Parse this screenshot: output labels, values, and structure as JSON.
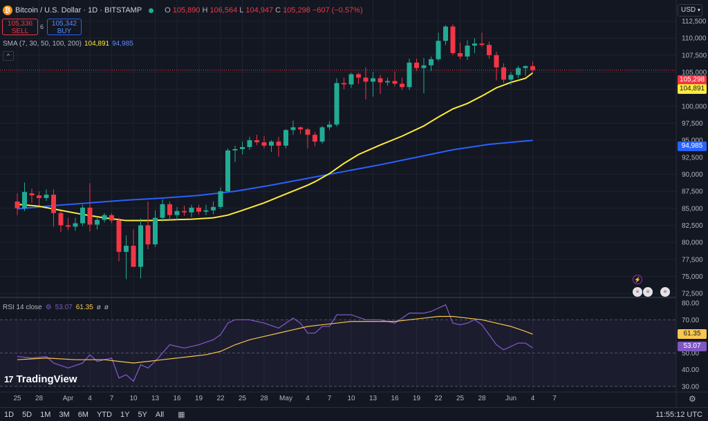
{
  "header": {
    "symbol": "Bitcoin / U.S. Dollar · 1D · BITSTAMP",
    "o_label": "O",
    "o_value": "105,890",
    "h_label": "H",
    "h_value": "106,564",
    "l_label": "L",
    "l_value": "104,947",
    "c_label": "C",
    "c_value": "105,298",
    "change": "−607 (−0.57%)"
  },
  "trade": {
    "sell_price": "105,336",
    "sell_label": "SELL",
    "spread": "6",
    "buy_price": "105,342",
    "buy_label": "BUY"
  },
  "indicators": {
    "sma_label": "SMA (7, 30, 50, 100, 200)",
    "sma_value_1": "104,891",
    "sma_value_2": "94,985",
    "rsi_label": "RSI 14 close",
    "rsi_value": "53.07",
    "rsi_ma_value": "61.35",
    "rsi_extra_1": "ø",
    "rsi_extra_2": "ø"
  },
  "currency_button": "USD",
  "price_tags": {
    "last": "105,298",
    "sma_fast": "104,891",
    "sma_slow": "94,985",
    "rsi_ma": "61.35",
    "rsi": "53.07"
  },
  "colors": {
    "up": "#22ab94",
    "down": "#f23645",
    "sma_fast": "#ffeb3b",
    "sma_slow": "#2962ff",
    "rsi": "#7e57c2",
    "rsi_ma": "#f9c74f"
  },
  "branding": "TradingView",
  "timeframes": [
    "1D",
    "5D",
    "1M",
    "3M",
    "6M",
    "YTD",
    "1Y",
    "5Y",
    "All"
  ],
  "clock": "11:55:12 UTC",
  "chart_data": {
    "type": "candlestick",
    "price_axis_labels": [
      "112,500",
      "110,000",
      "107,500",
      "105,000",
      "102,500",
      "100,000",
      "97,500",
      "95,000",
      "92,500",
      "90,000",
      "87,500",
      "85,000",
      "82,500",
      "80,000",
      "77,500",
      "75,000",
      "72,500"
    ],
    "price_ticks": [
      112500,
      110000,
      107500,
      105000,
      102500,
      100000,
      97500,
      95000,
      92500,
      90000,
      87500,
      85000,
      82500,
      80000,
      77500,
      75000,
      72500
    ],
    "ylim": [
      71800,
      115600
    ],
    "x_labels": [
      "25",
      "28",
      "Apr",
      "4",
      "7",
      "10",
      "13",
      "16",
      "19",
      "22",
      "25",
      "28",
      "May",
      "4",
      "7",
      "10",
      "13",
      "16",
      "19",
      "22",
      "25",
      "28",
      "Jun",
      "4",
      "7"
    ],
    "x_label_days": [
      0,
      3,
      7,
      10,
      13,
      16,
      19,
      22,
      25,
      28,
      31,
      34,
      37,
      40,
      43,
      46,
      49,
      52,
      55,
      58,
      61,
      64,
      68,
      71,
      74
    ],
    "candles": [
      [
        0,
        86000,
        87200,
        84000,
        85000
      ],
      [
        1,
        85000,
        88800,
        84600,
        87400
      ],
      [
        2,
        87200,
        87900,
        85800,
        86900
      ],
      [
        3,
        86900,
        87500,
        85400,
        86500
      ],
      [
        4,
        86500,
        87800,
        86100,
        87000
      ],
      [
        5,
        87000,
        87800,
        82300,
        84300
      ],
      [
        6,
        84300,
        84600,
        81500,
        82500
      ],
      [
        7,
        82500,
        83600,
        81800,
        82300
      ],
      [
        8,
        82300,
        83600,
        81700,
        82800
      ],
      [
        9,
        82800,
        85500,
        82400,
        85100
      ],
      [
        10,
        85100,
        88700,
        81600,
        82600
      ],
      [
        11,
        82600,
        83800,
        81900,
        83300
      ],
      [
        12,
        83300,
        84300,
        82900,
        84000
      ],
      [
        13,
        84000,
        84300,
        82800,
        83200
      ],
      [
        14,
        83200,
        83600,
        77200,
        78600
      ],
      [
        15,
        78600,
        81000,
        74600,
        79500
      ],
      [
        16,
        79500,
        81900,
        76600,
        76400
      ],
      [
        17,
        76400,
        83500,
        74700,
        82500
      ],
      [
        18,
        82500,
        86000,
        79000,
        79700
      ],
      [
        19,
        79700,
        84700,
        79300,
        83600
      ],
      [
        20,
        83600,
        86300,
        83000,
        85600
      ],
      [
        21,
        85600,
        86000,
        83300,
        84000
      ],
      [
        22,
        84000,
        85200,
        83300,
        84600
      ],
      [
        23,
        84600,
        85400,
        83900,
        84400
      ],
      [
        24,
        84400,
        85500,
        83700,
        85100
      ],
      [
        25,
        85100,
        85500,
        84100,
        84500
      ],
      [
        26,
        84500,
        85500,
        84000,
        84700
      ],
      [
        27,
        84700,
        86000,
        84100,
        85200
      ],
      [
        28,
        85200,
        88100,
        84900,
        87500
      ],
      [
        29,
        87500,
        93800,
        87400,
        93500
      ],
      [
        30,
        93500,
        94200,
        91800,
        93700
      ],
      [
        31,
        93700,
        94800,
        92900,
        94000
      ],
      [
        32,
        94000,
        95500,
        93600,
        95000
      ],
      [
        33,
        95000,
        95800,
        94300,
        94700
      ],
      [
        34,
        94700,
        95600,
        93800,
        94200
      ],
      [
        35,
        94200,
        95000,
        93300,
        94800
      ],
      [
        36,
        94800,
        95500,
        92600,
        94200
      ],
      [
        37,
        94200,
        96600,
        93800,
        96500
      ],
      [
        38,
        96500,
        97900,
        95800,
        96900
      ],
      [
        39,
        96900,
        97000,
        95900,
        96600
      ],
      [
        40,
        96600,
        96800,
        93800,
        95800
      ],
      [
        41,
        95800,
        96200,
        94100,
        94800
      ],
      [
        42,
        94800,
        97100,
        94500,
        96900
      ],
      [
        43,
        96900,
        97800,
        96500,
        97300
      ],
      [
        44,
        97300,
        104100,
        97000,
        103400
      ],
      [
        45,
        103400,
        104200,
        102500,
        103200
      ],
      [
        46,
        103200,
        104900,
        102700,
        104700
      ],
      [
        47,
        104700,
        104900,
        103300,
        104200
      ],
      [
        48,
        104200,
        105700,
        101000,
        103600
      ],
      [
        49,
        103600,
        105000,
        101400,
        104100
      ],
      [
        50,
        104100,
        104600,
        101800,
        103500
      ],
      [
        51,
        103500,
        104200,
        103000,
        103700
      ],
      [
        52,
        103700,
        105100,
        102900,
        103300
      ],
      [
        53,
        103300,
        104200,
        102400,
        102800
      ],
      [
        54,
        102800,
        107000,
        102400,
        106400
      ],
      [
        55,
        106400,
        107000,
        105200,
        105600
      ],
      [
        56,
        105600,
        107100,
        101900,
        106000
      ],
      [
        57,
        106000,
        107300,
        105200,
        106900
      ],
      [
        58,
        106900,
        110800,
        106600,
        109600
      ],
      [
        59,
        109600,
        111900,
        109000,
        111700
      ],
      [
        60,
        111700,
        112000,
        107500,
        107800
      ],
      [
        61,
        107800,
        109300,
        106900,
        107300
      ],
      [
        62,
        107300,
        109700,
        106800,
        108900
      ],
      [
        63,
        108900,
        110000,
        107800,
        109200
      ],
      [
        64,
        109200,
        110800,
        108700,
        109000
      ],
      [
        65,
        109000,
        109500,
        107000,
        107500
      ],
      [
        66,
        107500,
        108000,
        103800,
        105700
      ],
      [
        67,
        105700,
        106300,
        103400,
        103900
      ],
      [
        68,
        103900,
        105000,
        103100,
        104600
      ],
      [
        69,
        104600,
        105900,
        104100,
        105600
      ],
      [
        70,
        105600,
        106000,
        104500,
        105890
      ],
      [
        71,
        105890,
        106564,
        104947,
        105298
      ]
    ],
    "sma_fast": {
      "name": "SMA 30",
      "points": [
        [
          0,
          85600
        ],
        [
          3,
          85300
        ],
        [
          6,
          84700
        ],
        [
          9,
          84100
        ],
        [
          12,
          83600
        ],
        [
          15,
          83200
        ],
        [
          18,
          83200
        ],
        [
          21,
          83300
        ],
        [
          24,
          83400
        ],
        [
          27,
          83600
        ],
        [
          29,
          84000
        ],
        [
          31,
          84700
        ],
        [
          34,
          85800
        ],
        [
          37,
          87100
        ],
        [
          40,
          88400
        ],
        [
          41,
          88900
        ],
        [
          43,
          90100
        ],
        [
          45,
          91600
        ],
        [
          47,
          92900
        ],
        [
          50,
          94300
        ],
        [
          53,
          95600
        ],
        [
          56,
          97100
        ],
        [
          58,
          98400
        ],
        [
          60,
          99600
        ],
        [
          62,
          100400
        ],
        [
          64,
          101500
        ],
        [
          66,
          102700
        ],
        [
          68,
          103500
        ],
        [
          70,
          104100
        ],
        [
          71,
          104891
        ]
      ]
    },
    "sma_slow": {
      "name": "SMA 200",
      "points": [
        [
          0,
          84900
        ],
        [
          5,
          85400
        ],
        [
          10,
          85800
        ],
        [
          15,
          86200
        ],
        [
          20,
          86500
        ],
        [
          25,
          86900
        ],
        [
          30,
          87500
        ],
        [
          35,
          88400
        ],
        [
          40,
          89400
        ],
        [
          45,
          90400
        ],
        [
          50,
          91400
        ],
        [
          55,
          92500
        ],
        [
          60,
          93600
        ],
        [
          65,
          94400
        ],
        [
          71,
          94985
        ]
      ]
    },
    "rsi": {
      "ticks": [
        80,
        70,
        60,
        50,
        40,
        30
      ],
      "tick_labels": [
        "80.00",
        "70.00",
        "50.00",
        "40.00",
        "30.00"
      ],
      "ylim": [
        27,
        83
      ],
      "bands": [
        70,
        50,
        30
      ],
      "rsi_points": [
        [
          0,
          48
        ],
        [
          2,
          47
        ],
        [
          4,
          48
        ],
        [
          5,
          44
        ],
        [
          7,
          41
        ],
        [
          9,
          44
        ],
        [
          10,
          49
        ],
        [
          11,
          45
        ],
        [
          13,
          47
        ],
        [
          14,
          35
        ],
        [
          15,
          37
        ],
        [
          16,
          33
        ],
        [
          17,
          43
        ],
        [
          18,
          41
        ],
        [
          19,
          45
        ],
        [
          21,
          55
        ],
        [
          23,
          53
        ],
        [
          25,
          55
        ],
        [
          27,
          58
        ],
        [
          28,
          61
        ],
        [
          29,
          68
        ],
        [
          30,
          70
        ],
        [
          32,
          70
        ],
        [
          34,
          68
        ],
        [
          36,
          65
        ],
        [
          37,
          68
        ],
        [
          38,
          71
        ],
        [
          39,
          68
        ],
        [
          40,
          62
        ],
        [
          41,
          62
        ],
        [
          42,
          66
        ],
        [
          43,
          66
        ],
        [
          44,
          73
        ],
        [
          46,
          73
        ],
        [
          48,
          70
        ],
        [
          50,
          70
        ],
        [
          52,
          68
        ],
        [
          54,
          74
        ],
        [
          56,
          74
        ],
        [
          57,
          75
        ],
        [
          58,
          77
        ],
        [
          59,
          79
        ],
        [
          60,
          68
        ],
        [
          61,
          67
        ],
        [
          62,
          68
        ],
        [
          63,
          70
        ],
        [
          64,
          67
        ],
        [
          65,
          61
        ],
        [
          66,
          55
        ],
        [
          67,
          52
        ],
        [
          68,
          54
        ],
        [
          69,
          56
        ],
        [
          70,
          56
        ],
        [
          71,
          53.07
        ]
      ],
      "ma_points": [
        [
          0,
          46
        ],
        [
          4,
          47
        ],
        [
          8,
          46
        ],
        [
          12,
          46
        ],
        [
          14,
          45
        ],
        [
          16,
          44
        ],
        [
          18,
          45
        ],
        [
          20,
          46
        ],
        [
          22,
          47
        ],
        [
          24,
          48
        ],
        [
          26,
          49
        ],
        [
          28,
          51
        ],
        [
          30,
          55
        ],
        [
          32,
          58
        ],
        [
          34,
          60
        ],
        [
          36,
          62
        ],
        [
          38,
          64
        ],
        [
          40,
          66
        ],
        [
          42,
          67
        ],
        [
          44,
          68
        ],
        [
          46,
          69
        ],
        [
          48,
          69
        ],
        [
          50,
          69
        ],
        [
          52,
          69
        ],
        [
          54,
          70
        ],
        [
          56,
          71
        ],
        [
          58,
          72
        ],
        [
          60,
          72
        ],
        [
          62,
          71
        ],
        [
          64,
          70
        ],
        [
          66,
          68
        ],
        [
          68,
          66
        ],
        [
          70,
          63
        ],
        [
          71,
          61.35
        ]
      ]
    }
  }
}
